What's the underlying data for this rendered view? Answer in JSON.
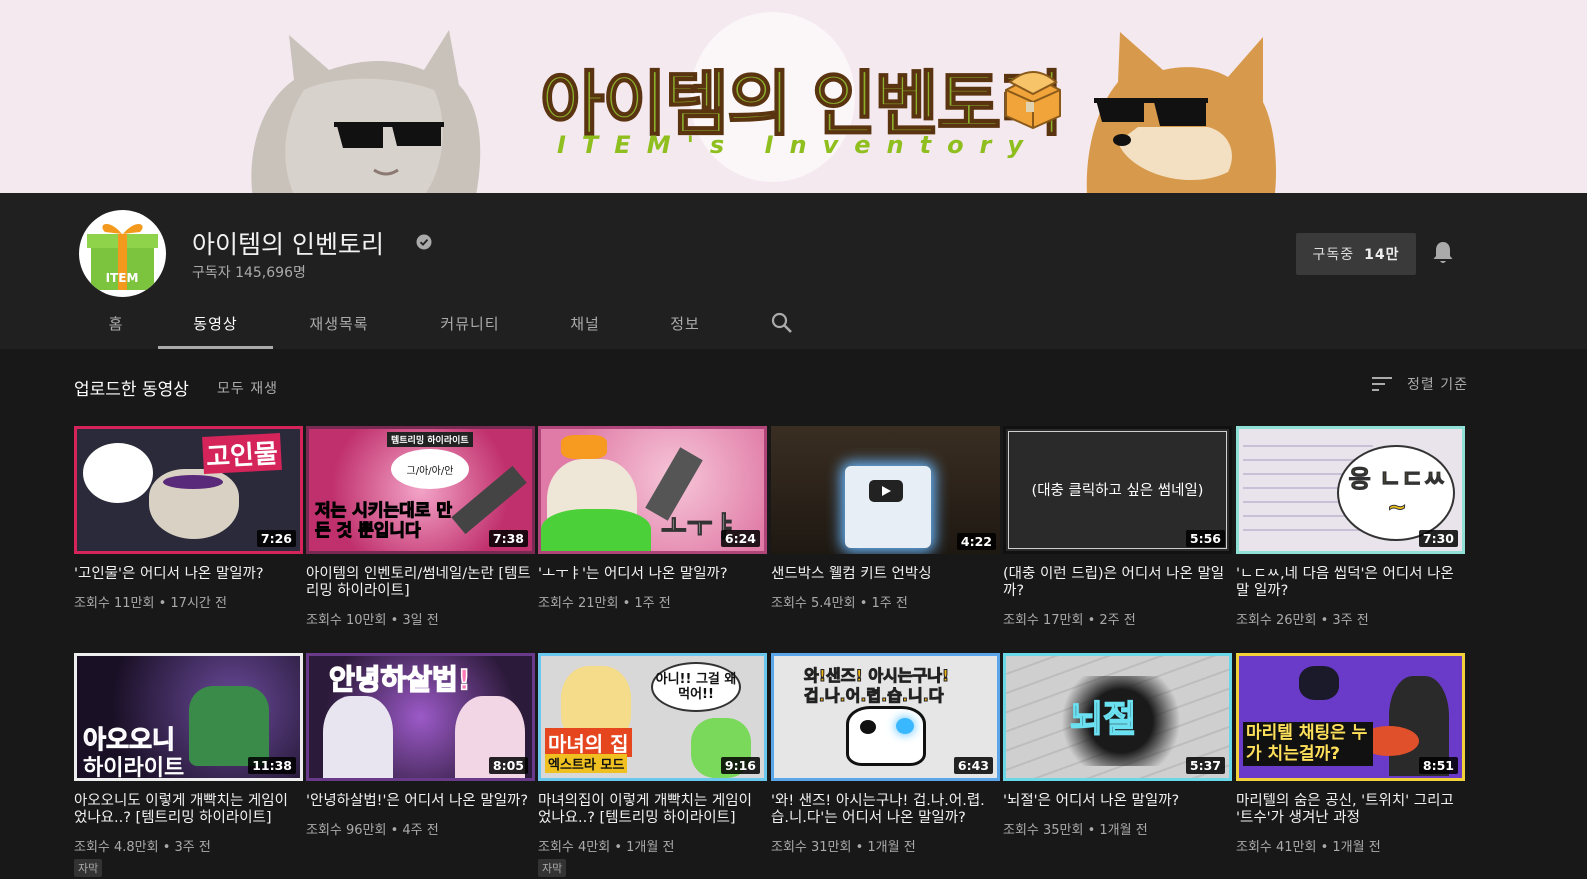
{
  "banner": {
    "title": "아이템의 인벤토리",
    "subtitle": "ITEM's Inventory"
  },
  "channel": {
    "name": "아이템의 인벤토리",
    "subscribers": "구독자 145,696명",
    "avatar_text": "ITEM",
    "subscribe_label": "구독중",
    "subscribe_count": "14만"
  },
  "tabs": [
    {
      "label": "홈"
    },
    {
      "label": "동영상"
    },
    {
      "label": "재생목록"
    },
    {
      "label": "커뮤니티"
    },
    {
      "label": "채널"
    },
    {
      "label": "정보"
    }
  ],
  "section": {
    "title": "업로드한 동영상",
    "play_all": "모두 재생",
    "sort_label": "정렬 기준"
  },
  "videos": [
    {
      "title": "'고인물'은 어디서 나온 말일까?",
      "meta": "조회수 11만회 • 17시간 전",
      "duration": "7:26",
      "thumb_text": "고인물",
      "badge": ""
    },
    {
      "title": "아이템의 인벤토리/썸네일/논란 [템트리밍 하이라이트]",
      "meta": "조회수 10만회 • 3일 전",
      "duration": "7:38",
      "thumb_text": "저는 시키는대로 만든 것 뿐입니다",
      "thumb_sub": "템트리밍 하이라이트",
      "bubble": "그/아/아/안",
      "badge": ""
    },
    {
      "title": "'ㅗㅜㅑ'는 어디서 나온 말일까?",
      "meta": "조회수 21만회 • 1주 전",
      "duration": "6:24",
      "thumb_text": "ㅗㅜㅑ",
      "badge": ""
    },
    {
      "title": "샌드박스 웰컴 키트 언박싱",
      "meta": "조회수 5.4만회 • 1주 전",
      "duration": "4:22",
      "thumb_text": "",
      "badge": ""
    },
    {
      "title": "(대충 이런 드립)은 어디서 나온 말일까?",
      "meta": "조회수 17만회 • 2주 전",
      "duration": "5:56",
      "thumb_text": "(대충 클릭하고 싶은 썸네일)",
      "badge": ""
    },
    {
      "title": "'ㄴㄷㅆ,네 다음 씹덕'은 어디서 나온 말 일까?",
      "meta": "조회수 26만회 • 3주 전",
      "duration": "7:30",
      "thumb_text": "응 ㄴㄷㅆ~",
      "badge": ""
    },
    {
      "title": "아오오니도 이렇게 개빡치는 게임이었나요..? [템트리밍 하이라이트]",
      "meta": "조회수 4.8만회 • 3주 전",
      "duration": "11:38",
      "thumb_text": "아오오니",
      "thumb_sub": "하이라이트",
      "badge": "자막"
    },
    {
      "title": "'안녕하살법!'은 어디서 나온 말일까?",
      "meta": "조회수 96만회 • 4주 전",
      "duration": "8:05",
      "thumb_text": "안녕하살법!",
      "badge": ""
    },
    {
      "title": "마녀의집이 이렇게 개빡치는 게임이었나요..? [템트리밍 하이라이트]",
      "meta": "조회수 4만회 • 1개월 전",
      "duration": "9:16",
      "thumb_text": "마녀의 집",
      "thumb_sub": "엑스트라 모드",
      "bubble": "아니!! 그걸 왜먹어!!",
      "badge": "자막"
    },
    {
      "title": "'와! 샌즈! 아시는구나! 겁.나.어.렵.습.니.다'는 어디서 나온 말일까?",
      "meta": "조회수 31만회 • 1개월 전",
      "duration": "6:43",
      "thumb_text": "와!샌즈! 아시는구나!",
      "thumb_sub": "겁.나.어.렵.습.니.다",
      "badge": ""
    },
    {
      "title": "'뇌절'은 어디서 나온 말일까?",
      "meta": "조회수 35만회 • 1개월 전",
      "duration": "5:37",
      "thumb_text": "뇌절",
      "badge": ""
    },
    {
      "title": "마리텔의 숨은 공신, '트위치' 그리고 '트수'가 생겨난 과정",
      "meta": "조회수 41만회 • 1개월 전",
      "duration": "8:51",
      "thumb_text": "마리텔 채팅은 누가 치는걸까?",
      "badge": ""
    }
  ],
  "colors": {
    "background": "#181818",
    "header": "#202020",
    "banner": "#f4e9ef",
    "accent_green": "#8bb12c"
  },
  "icons": [
    "verified-icon",
    "bell-icon",
    "search-icon",
    "sort-icon",
    "play-icon"
  ]
}
